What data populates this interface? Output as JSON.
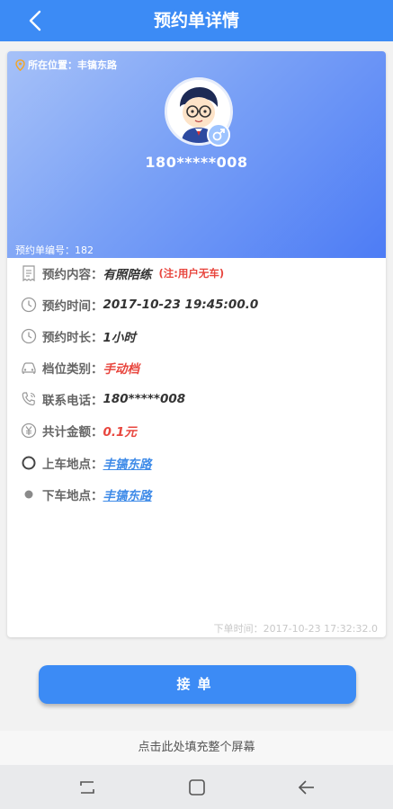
{
  "header": {
    "title": "预约单详情"
  },
  "hero": {
    "location_label": "所在位置：",
    "location_value": "丰镐东路",
    "phone": "180*****008",
    "order_no_label": "预约单编号：",
    "order_no_value": "182"
  },
  "details": [
    {
      "label": "预约内容：",
      "value": "有照陪练",
      "note": "(注:用户无车)",
      "icon": "receipt-icon"
    },
    {
      "label": "预约时间：",
      "value": "2017-10-23 19:45:00.0",
      "icon": "clock-icon"
    },
    {
      "label": "预约时长：",
      "value": "1小时",
      "icon": "clock-icon"
    },
    {
      "label": "档位类别：",
      "value": "手动档",
      "icon": "car-icon"
    },
    {
      "label": "联系电话：",
      "value": "180*****008",
      "icon": "phone-icon"
    },
    {
      "label": "共计金额：",
      "value": "0.1元",
      "icon": "yuan-icon"
    },
    {
      "label": "上车地点：",
      "value": "丰镐东路",
      "icon": "ring-icon"
    },
    {
      "label": "下车地点：",
      "value": "丰镐东路",
      "icon": "dot-icon"
    }
  ],
  "order_time": "下单时间：2017-10-23 17:32:32.0",
  "accept_label": "接单",
  "fill_hint": "点击此处填充整个屏幕",
  "colors": {
    "primary": "#3c8bf5",
    "red": "#e8463e",
    "link": "#3d8ae8"
  }
}
